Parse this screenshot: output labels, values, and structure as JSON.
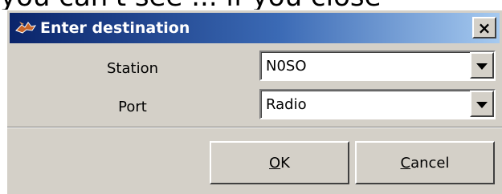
{
  "background_text": "you can't see ... if you close",
  "dialog": {
    "title": "Enter destination",
    "app_icon": "bird-icon",
    "close_label": "×",
    "colors": {
      "titlebar_start": "#0a246a",
      "titlebar_end": "#a6caf0",
      "face": "#d4d0c8"
    }
  },
  "fields": {
    "station": {
      "label": "Station",
      "value": "N0SO"
    },
    "port": {
      "label": "Port",
      "value": "Radio"
    }
  },
  "buttons": {
    "ok": {
      "mnemonic": "O",
      "rest": "K"
    },
    "cancel": {
      "mnemonic": "C",
      "rest": "ancel"
    }
  }
}
